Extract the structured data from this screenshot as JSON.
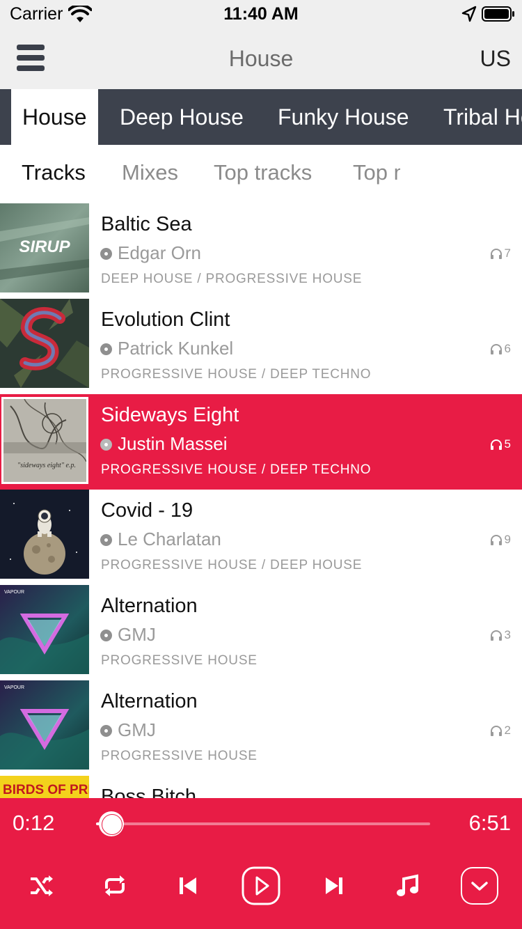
{
  "status_bar": {
    "carrier": "Carrier",
    "time": "11:40 AM"
  },
  "nav": {
    "title": "House",
    "region": "US",
    "menu_icon": "hamburger-menu-icon"
  },
  "genre_tabs": [
    {
      "label": "House",
      "active": true
    },
    {
      "label": "Deep House",
      "active": false
    },
    {
      "label": "Funky House",
      "active": false
    },
    {
      "label": "Tribal House",
      "active": false
    }
  ],
  "sub_tabs": [
    {
      "label": "Tracks",
      "active": true
    },
    {
      "label": "Mixes",
      "active": false
    },
    {
      "label": "Top tracks",
      "active": false
    },
    {
      "label": "Top mixes",
      "active": false
    }
  ],
  "tracks": [
    {
      "title": "Baltic Sea",
      "artist": "Edgar Orn",
      "genres": "DEEP HOUSE / PROGRESSIVE HOUSE",
      "plays": "7",
      "selected": false,
      "cover_text": "SIRUP"
    },
    {
      "title": "Evolution Clint",
      "artist": "Patrick Kunkel",
      "genres": "PROGRESSIVE HOUSE / DEEP TECHNO",
      "plays": "6",
      "selected": false
    },
    {
      "title": "Sideways Eight",
      "artist": "Justin Massei",
      "genres": "PROGRESSIVE HOUSE / DEEP TECHNO",
      "plays": "5",
      "selected": true,
      "cover_text": "\"sideways eight\" e.p."
    },
    {
      "title": "Covid - 19",
      "artist": "Le Charlatan",
      "genres": "PROGRESSIVE HOUSE / DEEP HOUSE",
      "plays": "9",
      "selected": false
    },
    {
      "title": "Alternation",
      "artist": "GMJ",
      "genres": "PROGRESSIVE HOUSE",
      "plays": "3",
      "selected": false,
      "cover_text": "VAPOUR"
    },
    {
      "title": "Alternation",
      "artist": "GMJ",
      "genres": "PROGRESSIVE HOUSE",
      "plays": "2",
      "selected": false,
      "cover_text": "VAPOUR"
    },
    {
      "title": "Boss Bitch",
      "artist": "",
      "genres": "",
      "plays": "",
      "selected": false,
      "cover_text": "BIRDS OF PREY"
    }
  ],
  "player": {
    "current_time": "0:12",
    "total_time": "6:51",
    "progress": 0.045,
    "controls": [
      "shuffle-icon",
      "repeat-icon",
      "skip-previous-icon",
      "play-icon",
      "skip-next-icon",
      "music-note-icon",
      "chevron-down-icon"
    ]
  },
  "colors": {
    "accent": "#e81c45",
    "tab_bar": "#3d424d",
    "nav_bg": "#efefef"
  }
}
